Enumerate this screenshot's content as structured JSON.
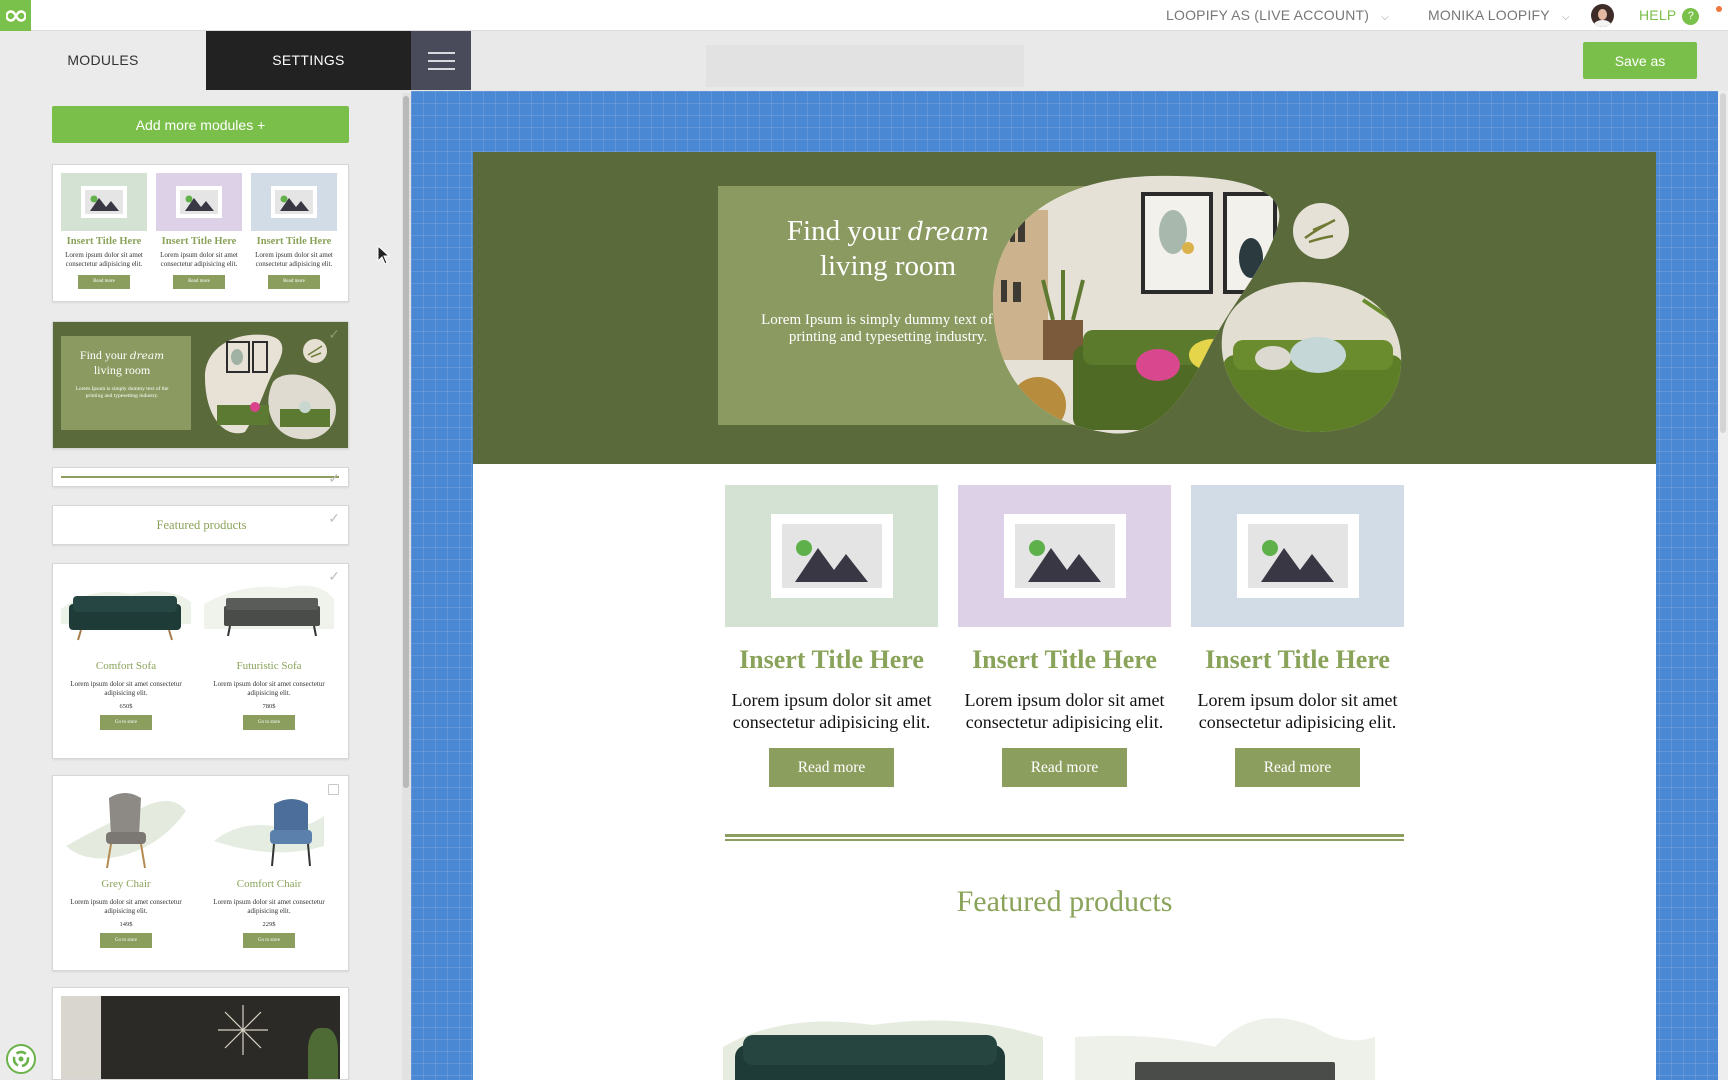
{
  "topbar": {
    "account": "LOOPIFY AS (LIVE ACCOUNT)",
    "user": "MONIKA LOOPIFY",
    "help": "HELP",
    "help_icon": "?"
  },
  "tabs": {
    "modules": "MODULES",
    "settings": "SETTINGS"
  },
  "left": {
    "add_button": "Add more modules +",
    "three_col": {
      "title": "Insert Title Here",
      "text": "Lorem ipsum dolor sit amet consectetur adipisicing elit.",
      "button": "Read more"
    },
    "hero": {
      "line1": "Find your",
      "script": "dream",
      "line2": "living room",
      "sub": "Lorem Ipsum is simply dummy text of the printing and typesetting industry."
    },
    "featured_label": "Featured products",
    "sofas": [
      {
        "name": "Comfort Sofa",
        "text": "Lorem ipsum dolor sit amet consectetur adipisicing elit.",
        "price": "650$",
        "button": "Go to store"
      },
      {
        "name": "Futuristic Sofa",
        "text": "Lorem ipsum dolor sit amet consectetur adipisicing elit.",
        "price": "780$",
        "button": "Go to store"
      }
    ],
    "chairs": [
      {
        "name": "Grey Chair",
        "text": "Lorem ipsum dolor sit amet consectetur adipisicing elit.",
        "price": "149$",
        "button": "Go to store"
      },
      {
        "name": "Comfort Chair",
        "text": "Lorem ipsum dolor sit amet consectetur adipisicing elit.",
        "price": "229$",
        "button": "Go to store"
      }
    ]
  },
  "toolbar": {
    "save": "Save as"
  },
  "email": {
    "hero": {
      "line1": "Find your",
      "script": "dream",
      "line2": "living room",
      "sub": "Lorem Ipsum is simply dummy text of the printing and typesetting industry."
    },
    "columns": [
      {
        "title": "Insert Title Here",
        "text": "Lorem ipsum dolor sit amet consectetur adipisicing elit.",
        "button": "Read more",
        "bg": "#d4e2d3"
      },
      {
        "title": "Insert Title Here",
        "text": "Lorem ipsum dolor sit amet consectetur adipisicing elit.",
        "button": "Read more",
        "bg": "#dcd1e6"
      },
      {
        "title": "Insert Title Here",
        "text": "Lorem ipsum dolor sit amet consectetur adipisicing elit.",
        "button": "Read more",
        "bg": "#d1dce6"
      }
    ],
    "featured": "Featured products"
  },
  "colors": {
    "accent_green": "#7bbf4b",
    "olive": "#5a6a3b",
    "sage": "#8b9e5e",
    "title_green": "#8aa35a",
    "canvas_blue": "#4a88d4"
  }
}
